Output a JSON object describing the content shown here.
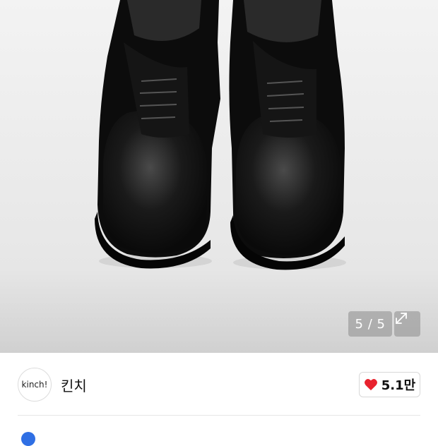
{
  "gallery": {
    "image_alt": "black leather derby shoes",
    "counter": "5 / 5",
    "expand_icon": "expand-icon"
  },
  "shop": {
    "logo_text": "kinch!",
    "name": "킨치"
  },
  "like": {
    "icon": "heart-icon",
    "count": "5.1만",
    "color": "#e8222e"
  },
  "colors": {
    "info_dot": "#2f6fe4"
  }
}
